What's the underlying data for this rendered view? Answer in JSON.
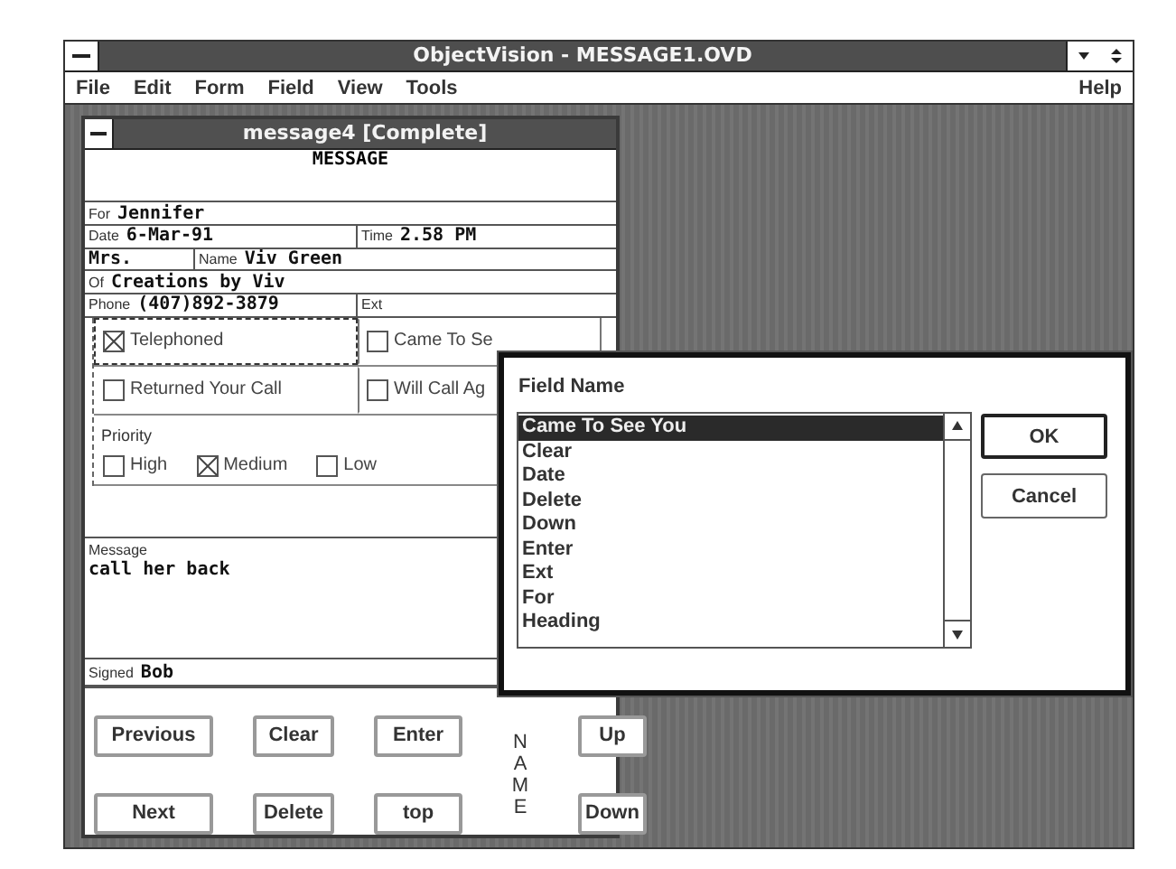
{
  "window": {
    "title": "ObjectVision - MESSAGE1.OVD"
  },
  "menu": [
    {
      "label": "File"
    },
    {
      "label": "Edit"
    },
    {
      "label": "Form"
    },
    {
      "label": "Field"
    },
    {
      "label": "View"
    },
    {
      "label": "Tools"
    }
  ],
  "help_menu": {
    "label": "Help"
  },
  "form": {
    "title": "message4 [Complete]",
    "heading": "MESSAGE",
    "rows": [
      {
        "cells": [
          {
            "label": "For",
            "value": "Jennifer"
          }
        ]
      },
      {
        "cells": [
          {
            "label": "Date",
            "value": "6-Mar-91"
          },
          {
            "label": "Time",
            "value": "2.58 PM"
          }
        ]
      },
      {
        "cells": [
          {
            "value": "Mrs."
          },
          {
            "label": "Name",
            "value": "Viv Green"
          }
        ]
      },
      {
        "cells": [
          {
            "label": "Of",
            "value": "Creations by Viv"
          }
        ]
      },
      {
        "cells": [
          {
            "label": "Phone",
            "value": "(407)892-3879"
          },
          {
            "label": "Ext"
          }
        ]
      }
    ],
    "checkboxes": [
      {
        "label": "Telephoned",
        "checked": true,
        "focused": true
      },
      {
        "label": "Came To Se",
        "checked": false,
        "focused": false
      },
      {
        "label": "Returned Your Call",
        "checked": false,
        "focused": false
      },
      {
        "label": "Will Call Ag",
        "checked": false,
        "focused": false
      }
    ],
    "priority": {
      "label": "Priority",
      "options": [
        {
          "label": "High",
          "checked": false
        },
        {
          "label": "Medium",
          "checked": true
        },
        {
          "label": "Low",
          "checked": false
        }
      ]
    },
    "message": {
      "label": "Message",
      "value": "call her back"
    },
    "signed": {
      "label": "Signed",
      "value": "Bob"
    },
    "buttons": [
      {
        "label": "Previous"
      },
      {
        "label": "Clear"
      },
      {
        "label": "Enter"
      },
      {
        "label": "Up"
      },
      {
        "label": "Next"
      },
      {
        "label": "Delete"
      },
      {
        "label": "top"
      },
      {
        "label": "Down"
      }
    ],
    "button_group_label": "NAME"
  },
  "dialog": {
    "label": "Field Name",
    "items": [
      {
        "label": "Came To See You",
        "selected": true
      },
      {
        "label": "Clear",
        "selected": false
      },
      {
        "label": "Date",
        "selected": false
      },
      {
        "label": "Delete",
        "selected": false
      },
      {
        "label": "Down",
        "selected": false
      },
      {
        "label": "Enter",
        "selected": false
      },
      {
        "label": "Ext",
        "selected": false
      },
      {
        "label": "For",
        "selected": false
      },
      {
        "label": "Heading",
        "selected": false
      }
    ],
    "buttons": [
      {
        "label": "OK",
        "default": true
      },
      {
        "label": "Cancel",
        "default": false
      }
    ]
  }
}
